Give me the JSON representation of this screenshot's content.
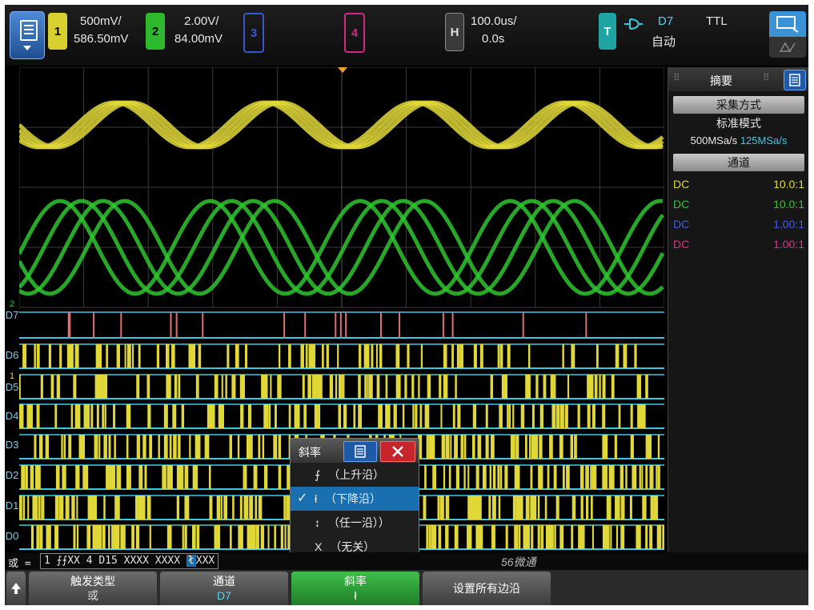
{
  "topbar": {
    "ch1": {
      "num": "1",
      "scale": "500mV/",
      "offset": "586.50mV",
      "color": "#e0d838"
    },
    "ch2": {
      "num": "2",
      "scale": "2.00V/",
      "offset": "84.00mV",
      "color": "#2fc62f"
    },
    "ch3": {
      "num": "3",
      "color": "#4060e0"
    },
    "ch4": {
      "num": "4",
      "color": "#e0308a"
    },
    "horizontal": {
      "label": "H",
      "scale": "100.0us/",
      "delay": "0.0s"
    },
    "trigger": {
      "label": "T",
      "source": "D7",
      "mode": "自动",
      "level": "TTL"
    }
  },
  "plot": {
    "digital_labels": [
      "D7",
      "D6",
      "D5",
      "D4",
      "D3",
      "D2",
      "D1",
      "D0"
    ],
    "marker_labels": [
      "2",
      "1"
    ]
  },
  "panel": {
    "title": "摘要",
    "acq_header": "采集方式",
    "acq_mode": "标准模式",
    "rate_a": "500MSa/s",
    "rate_b": "125MSa/s",
    "channel_header": "通道",
    "channels": [
      {
        "coupling": "DC",
        "probe": "10.0:1",
        "color": "#e0d838"
      },
      {
        "coupling": "DC",
        "probe": "10.0:1",
        "color": "#2fc62f"
      },
      {
        "coupling": "DC",
        "probe": "1.00:1",
        "color": "#4060e0"
      },
      {
        "coupling": "DC",
        "probe": "1.00:1",
        "color": "#e0308a"
      }
    ]
  },
  "popup": {
    "title": "斜率",
    "items": [
      {
        "glyph": "⨍",
        "label": "（上升沿）"
      },
      {
        "glyph": "ł",
        "label": "（下降沿）",
        "selected": true
      },
      {
        "glyph": "↕",
        "label": "（任一沿））"
      },
      {
        "glyph": "X",
        "label": "（无关）"
      }
    ]
  },
  "status": {
    "prefix": "或 =",
    "pattern": "1 ⨍⨍XX 4 D15 XXXX XXXX",
    "highlight": "ł",
    "tail": "XXX"
  },
  "softkeys": [
    {
      "title": "触发类型",
      "value": "或"
    },
    {
      "title": "通道",
      "value": "D7"
    },
    {
      "title": "斜率",
      "value": "ł"
    },
    {
      "title": "设置所有边沿",
      "value": ""
    }
  ],
  "watermark": "56微通"
}
